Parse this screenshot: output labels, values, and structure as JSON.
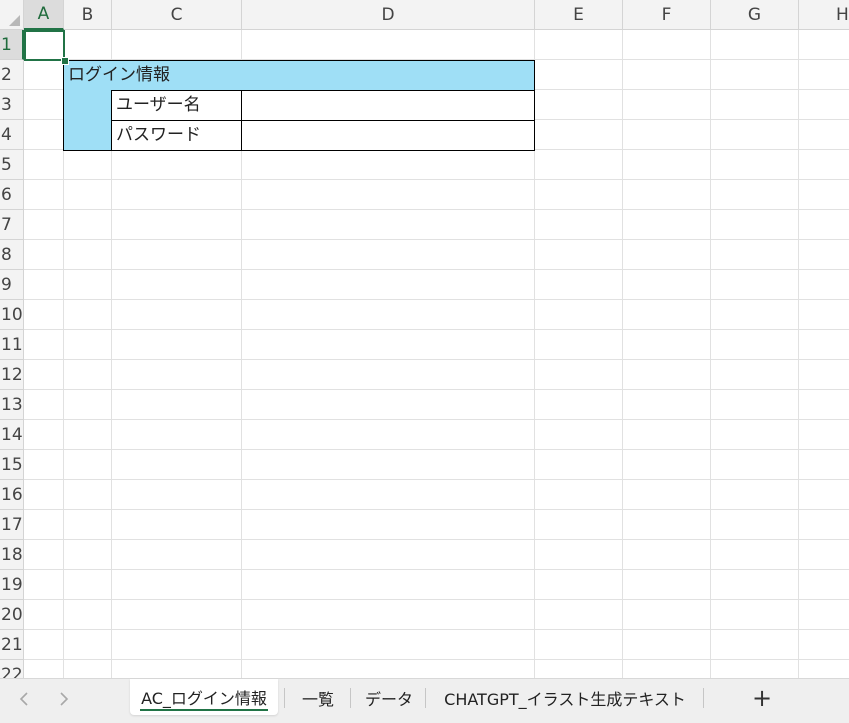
{
  "sheet": {
    "columns": [
      "A",
      "B",
      "C",
      "D",
      "E",
      "F",
      "G",
      "H"
    ],
    "rows": [
      "1",
      "2",
      "3",
      "4",
      "5",
      "6",
      "7",
      "8",
      "9",
      "10",
      "11",
      "12",
      "13",
      "14",
      "15",
      "16",
      "17",
      "18",
      "19",
      "20",
      "21",
      "22"
    ],
    "selected_cell": "A1",
    "cells": {
      "B2": "ログイン情報",
      "C3": "ユーザー名",
      "C4": "パスワード",
      "D3": "",
      "D4": ""
    }
  },
  "tabs": {
    "prev_icon": "chevron-left-icon",
    "next_icon": "chevron-right-icon",
    "items": [
      {
        "label": "AC_ログイン情報",
        "active": true
      },
      {
        "label": "一覧",
        "active": false
      },
      {
        "label": "データ",
        "active": false
      },
      {
        "label": "CHATGPT_イラスト生成テキスト",
        "active": false
      }
    ],
    "add_icon": "plus-icon",
    "add_label": "+"
  },
  "colors": {
    "accent": "#217346",
    "header_fill": "#9fdff6"
  }
}
